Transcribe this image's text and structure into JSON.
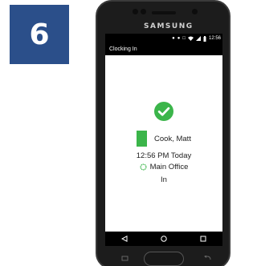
{
  "step": {
    "number": "6"
  },
  "colors": {
    "badge": "#2b4f8a",
    "success": "#3bb54a",
    "screen_background": "#ffffff",
    "bars": "#000000"
  },
  "device": {
    "brand": "SAMSUNG"
  },
  "status_bar": {
    "time": "12:56",
    "icons": [
      "location-icon",
      "alarm-icon",
      "nfc-icon",
      "wifi-icon",
      "signal-icon",
      "battery-icon"
    ]
  },
  "app_bar": {
    "title": "Clocking In"
  },
  "confirmation": {
    "icon": "check-circle-icon",
    "employee_name": "Cook, Matt",
    "time": "12:56 PM Today",
    "location_icon": "location-ring-icon",
    "location": "Main Office",
    "status": "In"
  },
  "nav_bar": {
    "buttons": [
      "back-icon",
      "home-icon",
      "recents-icon"
    ]
  }
}
